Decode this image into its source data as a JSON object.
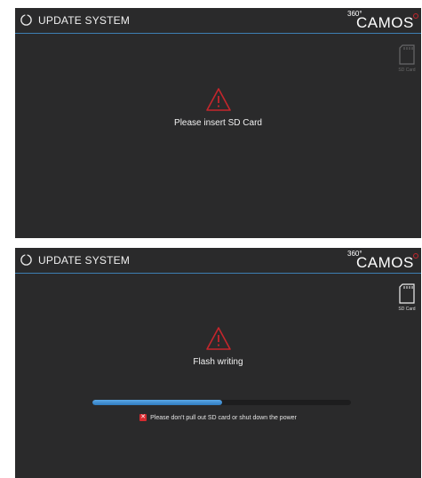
{
  "screens": [
    {
      "title": "UPDATE SYSTEM",
      "logo": {
        "prefix": "360°",
        "name": "CAMOS"
      },
      "sd_card_label": "SD Card",
      "message": "Please insert SD Card"
    },
    {
      "title": "UPDATE SYSTEM",
      "logo": {
        "prefix": "360°",
        "name": "CAMOS"
      },
      "sd_card_label": "SD Card",
      "message": "Flash writing",
      "progress_fraction": 0.5,
      "notice": "Please don't pull out SD card or shut down the power"
    }
  ],
  "colors": {
    "background": "#2a2a2b",
    "header_line": "#3d7fb3",
    "warning_red": "#c4262c",
    "progress_blue": "#3f8fd6"
  },
  "icons": {
    "title": "power-icon",
    "sd": "sd-card-icon",
    "warning": "warning-triangle-icon",
    "notice": "close-x-icon"
  }
}
